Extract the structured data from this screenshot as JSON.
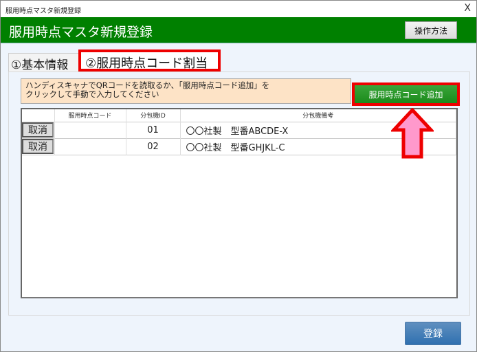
{
  "window": {
    "title": "服用時点マスタ新規登録",
    "close": "X"
  },
  "header": {
    "title": "服用時点マスタ新規登録",
    "help_label": "操作方法"
  },
  "tabs": [
    {
      "label": "①基本情報"
    },
    {
      "label": "②服用時点コード割当"
    }
  ],
  "info": {
    "line1": "ハンディスキャナでQRコードを読取るか、「服用時点コード追加」を",
    "line2": "クリックして手動で入力してください"
  },
  "add_button": "服用時点コード追加",
  "table": {
    "columns": [
      "",
      "服用時点コード",
      "分包機ID",
      "分包機備考"
    ],
    "rows": [
      {
        "action": "取消",
        "code": "",
        "id": "01",
        "remark": "〇〇社製　型番ABCDE-X"
      },
      {
        "action": "取消",
        "code": "",
        "id": "02",
        "remark": "〇〇社製　型番GHJKL-C"
      }
    ]
  },
  "register_button": "登録",
  "colors": {
    "header": "#008000",
    "highlight": "#ee0000",
    "arrow": "#ff99cc"
  }
}
